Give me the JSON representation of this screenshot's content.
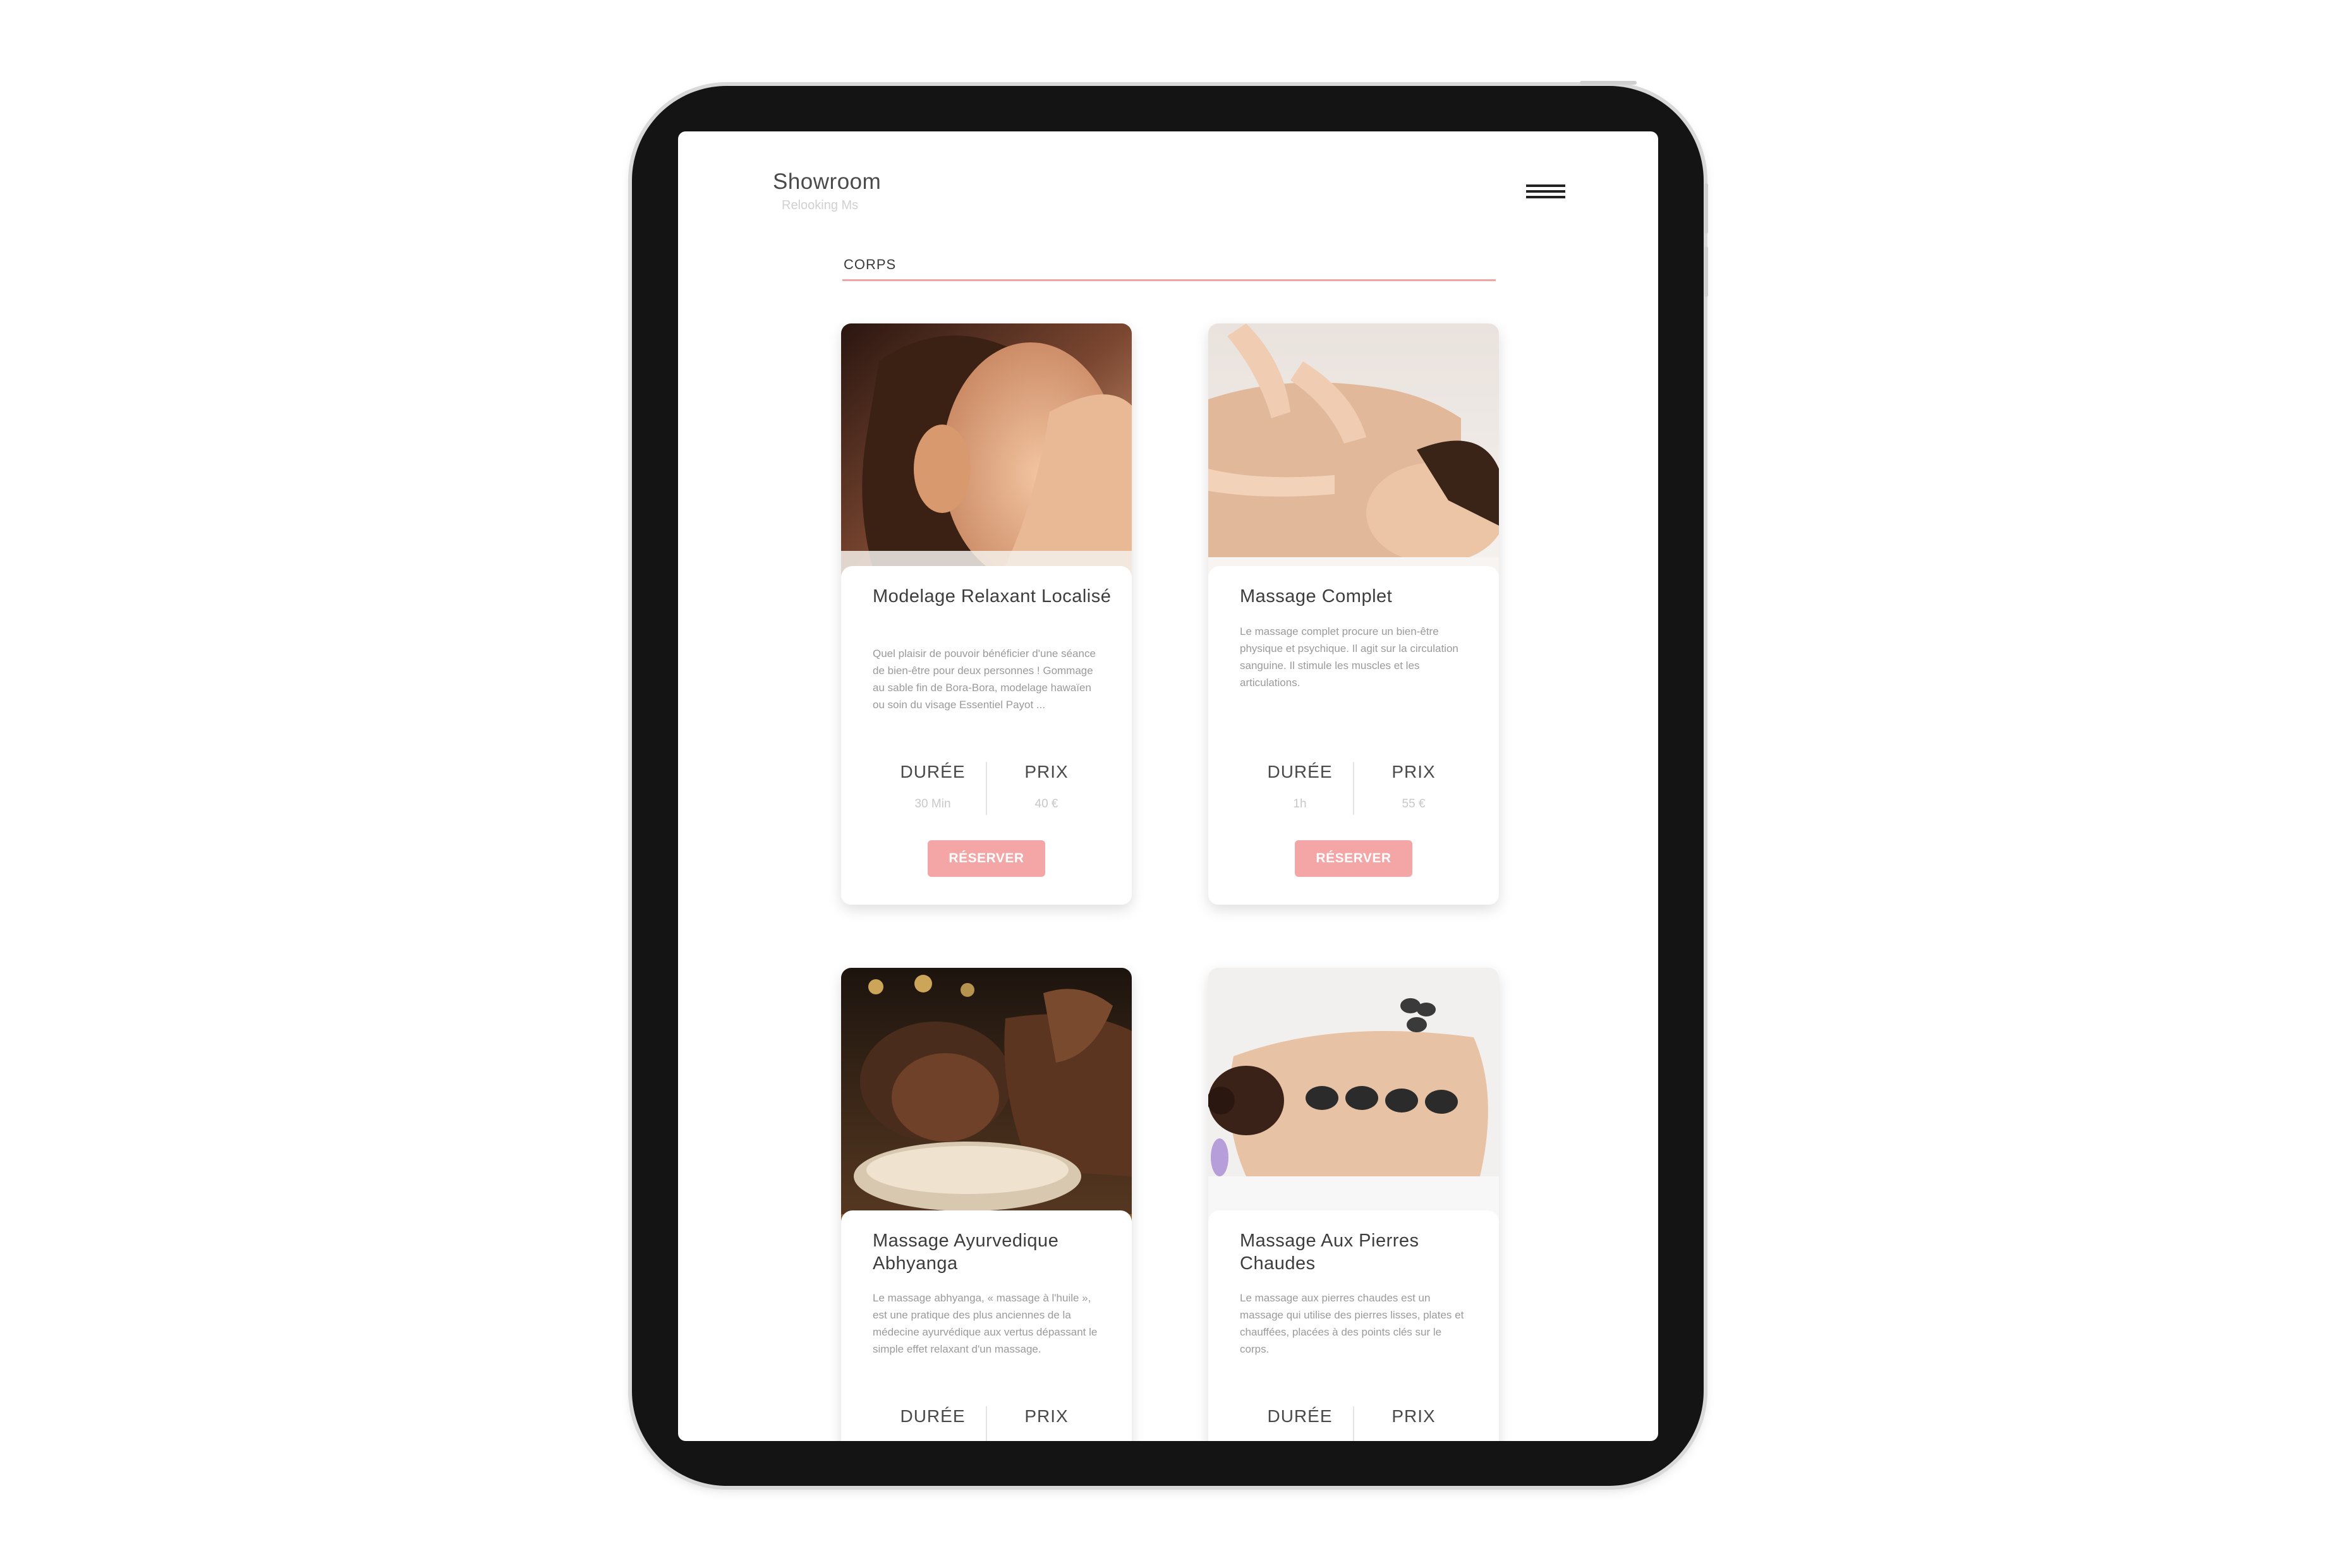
{
  "header": {
    "brand_title": "Showroom",
    "brand_subtitle": "Relooking Ms",
    "menu_icon": "hamburger-menu-icon"
  },
  "section": {
    "title": "CORPS"
  },
  "cards": [
    {
      "title": "Modelage Relaxant Localisé",
      "description": "Quel plaisir de pouvoir bénéficier d'une séance de bien-être pour deux personnes ! Gommage au sable fin de Bora-Bora, modelage hawaïen ou soin du visage Essentiel Payot ...",
      "duration_label": "DURÉE",
      "duration_value": "30 Min",
      "price_label": "PRIX",
      "price_value": "40 €",
      "button_label": "RÉSERVER"
    },
    {
      "title": "Massage Complet",
      "description": "Le massage complet procure un bien-être physique et psychique. Il agit sur la circulation sanguine. Il stimule les muscles et les articulations.",
      "duration_label": "DURÉE",
      "duration_value": "1h",
      "price_label": "PRIX",
      "price_value": "55 €",
      "button_label": "RÉSERVER"
    },
    {
      "title": "Massage Ayurvedique Abhyanga",
      "description": "Le massage abhyanga, « massage à l'huile », est une pratique des plus anciennes de la médecine ayurvédique aux vertus dépassant le simple effet relaxant d'un massage.",
      "duration_label": "DURÉE",
      "price_label": "PRIX"
    },
    {
      "title": "Massage Aux Pierres Chaudes",
      "description": "Le massage aux pierres chaudes est un massage qui utilise des pierres lisses, plates et chauffées, placées à des points clés sur le corps.",
      "duration_label": "DURÉE",
      "price_label": "PRIX"
    }
  ],
  "colors": {
    "accent": "#f4a5a5",
    "frame": "#141414",
    "text": "#3d3d3d"
  }
}
